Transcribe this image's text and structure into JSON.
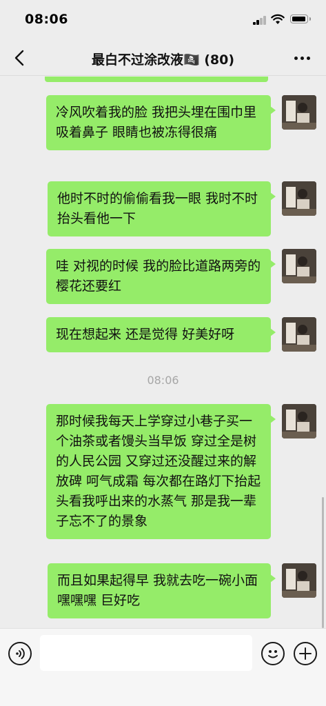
{
  "status_bar": {
    "time": "08:06"
  },
  "header": {
    "title": "最白不过涂改液🏴‍☠️ (80)"
  },
  "messages": [
    {
      "text": "冷风吹着我的脸 我把头埋在围巾里 吸着鼻子 眼睛也被冻得很痛"
    },
    {
      "text": "他时不时的偷偷看我一眼 我时不时抬头看他一下"
    },
    {
      "text": "哇 对视的时候 我的脸比道路两旁的樱花还要红"
    },
    {
      "text": "现在想起来 还是觉得 好美好呀"
    },
    {
      "text": "那时候我每天上学穿过小巷子买一个油茶或者馒头当早饭 穿过全是树的人民公园 又穿过还没醒过来的解放碑 呵气成霜 每次都在路灯下抬起头看我呼出来的水蒸气 那是我一辈子忘不了的景象"
    },
    {
      "text": "而且如果起得早 我就去吃一碗小面 嘿嘿嘿 巨好吃"
    }
  ],
  "timestamp": "08:06",
  "input": {
    "value": "",
    "placeholder": ""
  },
  "colors": {
    "bubble": "#95ec69",
    "background": "#ededed"
  }
}
